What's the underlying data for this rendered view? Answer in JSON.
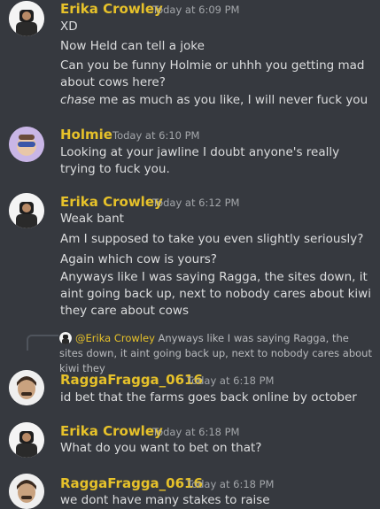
{
  "colors": {
    "background": "#36393f",
    "erika": "#e6c12a",
    "holmie": "#e6c12a",
    "ragga": "#e6c12a",
    "text": "#dcddde",
    "timestamp": "#a3a6aa"
  },
  "messages": [
    {
      "author": "Erika Crowley",
      "time": "Today at 6:09 PM",
      "lines": [
        "XD",
        "Now Held can tell a joke",
        "Can you be funny Holmie or uhhh you getting mad about cows here?"
      ],
      "italic_line": {
        "em": "chase",
        "rest": " me as much as you like, I will never fuck you"
      }
    },
    {
      "author": "Holmie",
      "time": "Today at 6:10 PM",
      "lines": [
        "Looking at your jawline I doubt anyone's really trying to fuck you."
      ]
    },
    {
      "author": "Erika Crowley",
      "time": "Today at 6:12 PM",
      "lines": [
        "Weak bant",
        "Am I supposed to take you even slightly seriously?",
        "Again which cow is yours?",
        "Anyways like I was saying Ragga, the sites down, it aint going back up, next to nobody cares about kiwi they care about cows"
      ]
    },
    {
      "author": "RaggaFragga_0616",
      "time": "Today at 6:18 PM",
      "reply": {
        "mention": "@Erika Crowley",
        "text": " Anyways like I was saying Ragga, the sites down, it aint going back up, next to nobody cares about kiwi they"
      },
      "lines": [
        "id bet that the farms goes back online by october"
      ]
    },
    {
      "author": "Erika Crowley",
      "time": "Today at 6:18 PM",
      "lines": [
        "What do you want to bet on that?"
      ]
    },
    {
      "author": "RaggaFragga_0616",
      "time": "Today at 6:18 PM",
      "lines": [
        "we dont have many stakes to raise"
      ]
    }
  ]
}
